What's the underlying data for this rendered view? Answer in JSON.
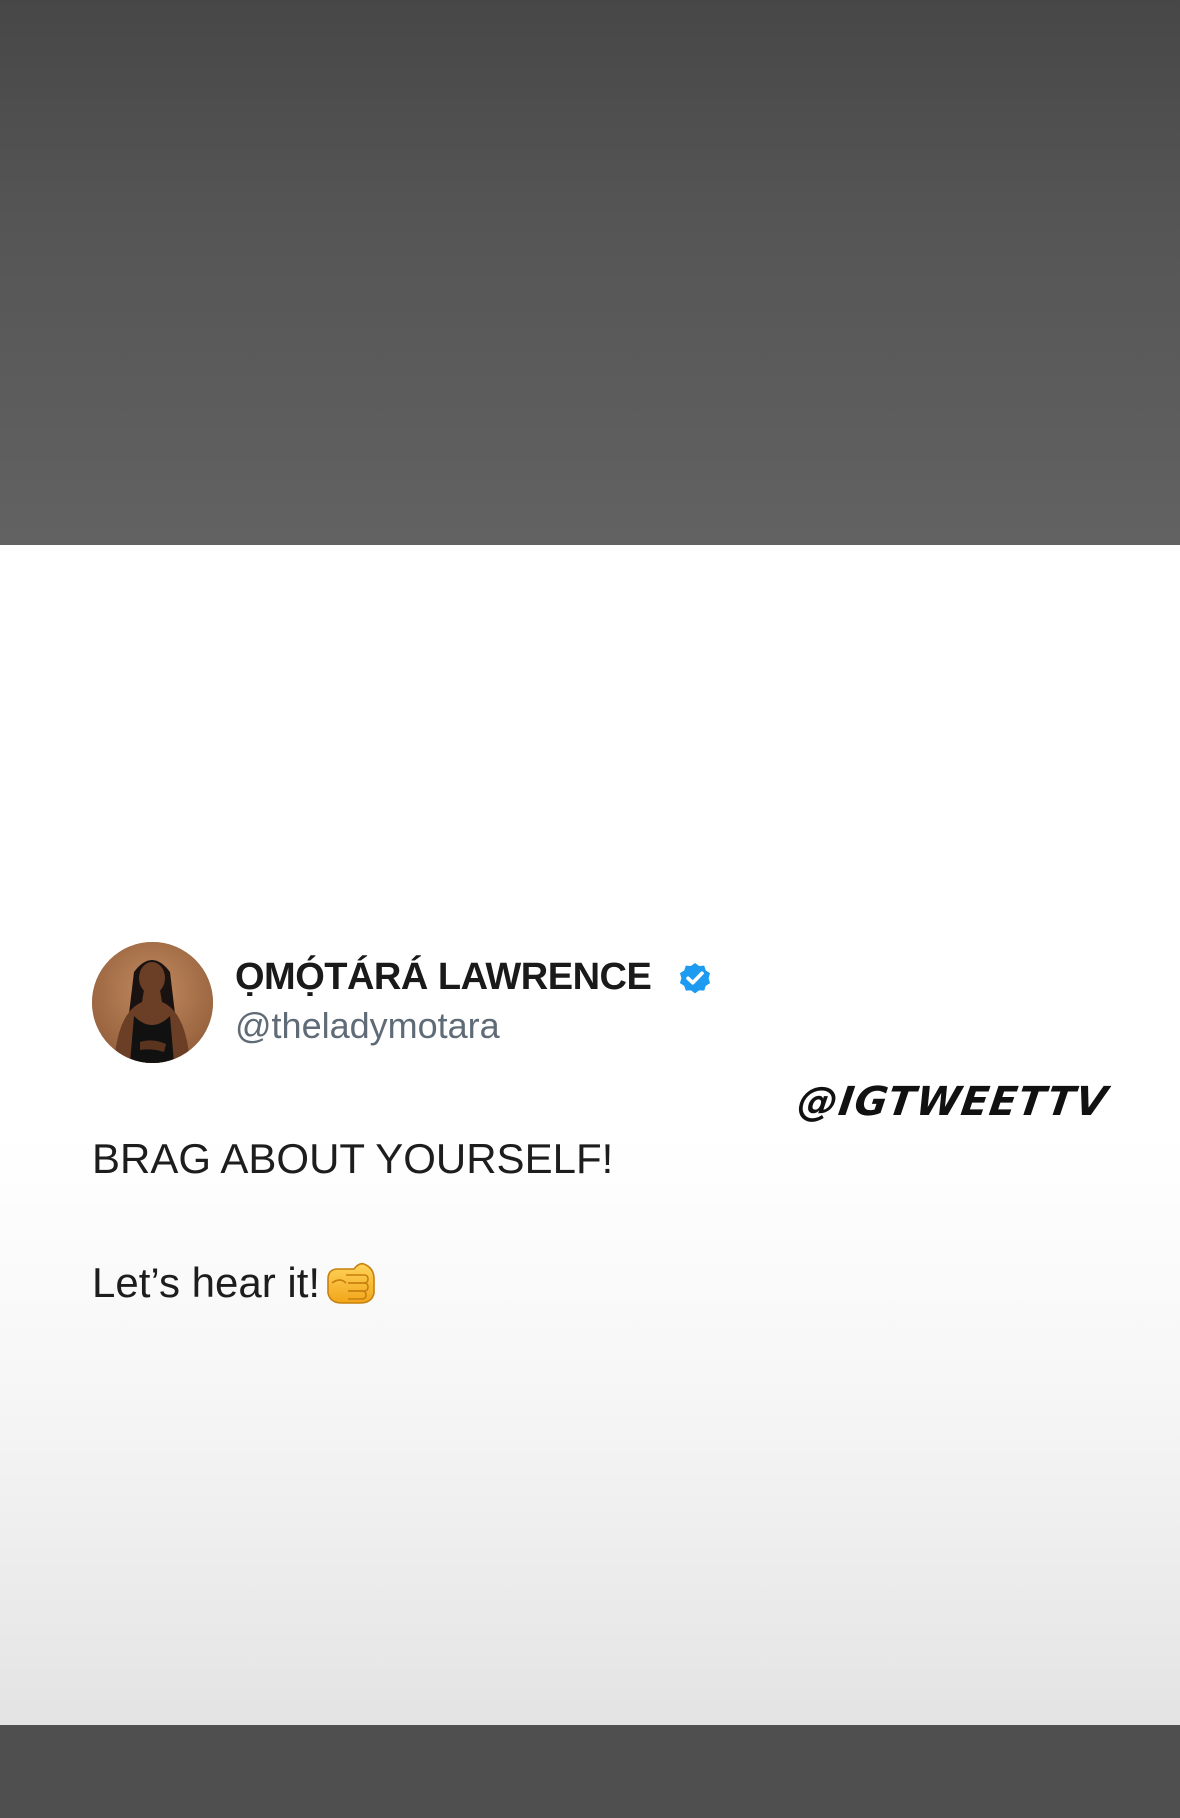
{
  "tweet": {
    "display_name": "ỌMỌ́TÁRÁ LAWRENCE",
    "handle": "@theladymotara",
    "verified": true,
    "line1": "BRAG ABOUT YOURSELF!",
    "line2": "Let’s hear it!",
    "emoji": "pointing-fist-emoji"
  },
  "watermark": {
    "text": "@IGTWEETTV"
  },
  "colors": {
    "verified_badge": "#1d9bf0",
    "handle_text": "#5f6b76",
    "name_text": "#1a1a1a"
  }
}
